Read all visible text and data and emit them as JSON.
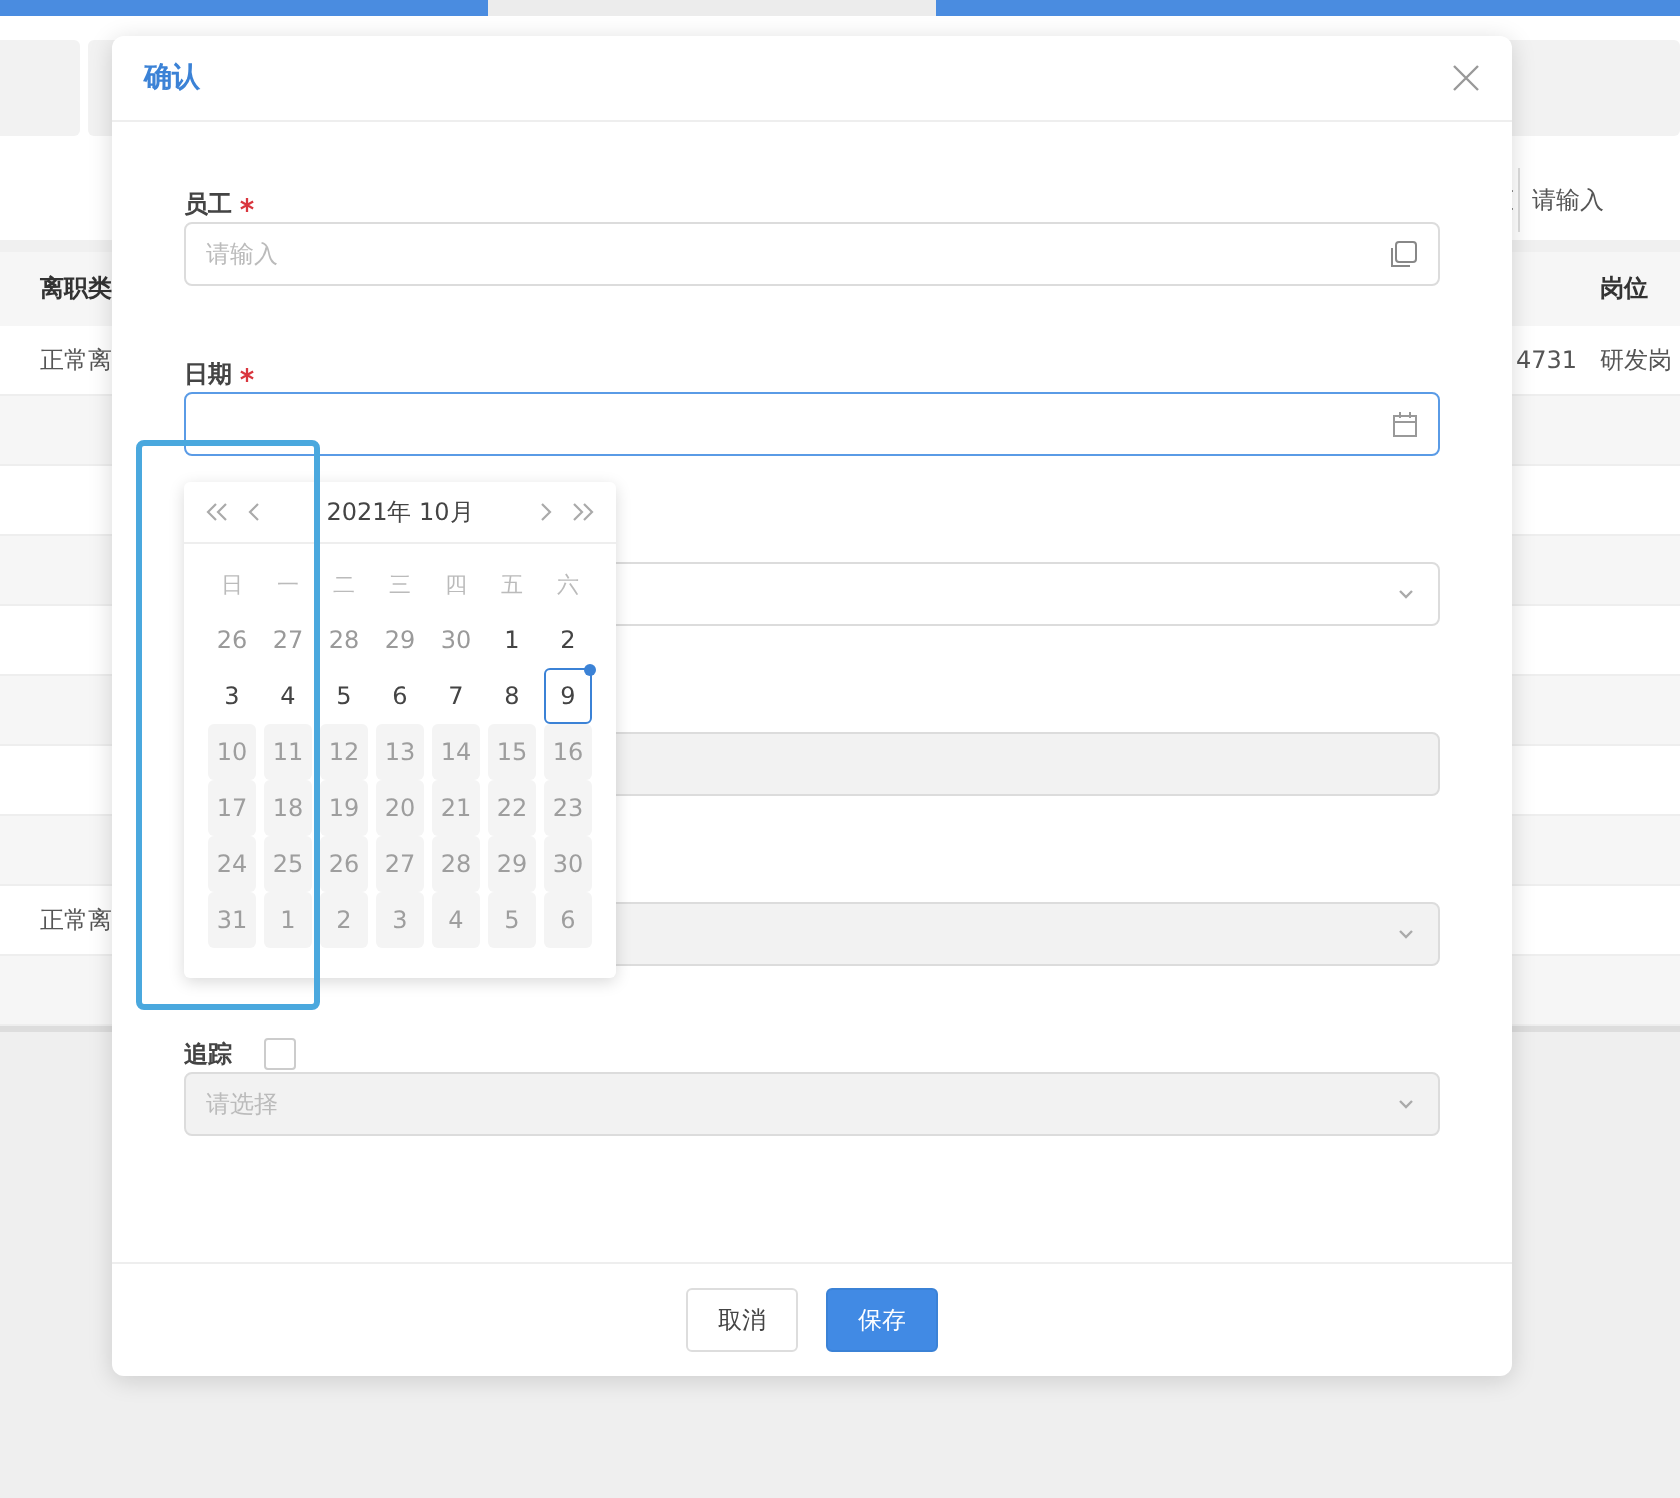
{
  "background": {
    "search": {
      "placeholder": "请输入"
    },
    "table": {
      "columns": [
        "离职类",
        "",
        "岗位"
      ],
      "rows": [
        {
          "cells": [
            "正常离",
            "4731",
            "研发岗"
          ]
        },
        {
          "cells": [
            "",
            "",
            ""
          ]
        },
        {
          "cells": [
            "",
            "",
            ""
          ]
        },
        {
          "cells": [
            "",
            "",
            ""
          ]
        },
        {
          "cells": [
            "",
            "",
            ""
          ]
        },
        {
          "cells": [
            "",
            "",
            ""
          ]
        },
        {
          "cells": [
            "",
            "",
            ""
          ]
        },
        {
          "cells": [
            "",
            "",
            ""
          ]
        },
        {
          "cells": [
            "正常离",
            "",
            ""
          ]
        },
        {
          "cells": [
            "",
            "",
            ""
          ]
        }
      ]
    }
  },
  "dialog": {
    "title": "确认",
    "fields": [
      {
        "kind": "text",
        "label": "员工",
        "required": true,
        "placeholder": "请输入",
        "disabled": false,
        "focused": false
      },
      {
        "kind": "date",
        "label": "日期",
        "required": true,
        "disabled": false,
        "focused": true
      },
      {
        "kind": "select",
        "disabled": false,
        "focused": false
      },
      {
        "kind": "text",
        "disabled": true,
        "focused": false
      },
      {
        "kind": "select",
        "disabled": true,
        "focused": false
      },
      {
        "kind": "select",
        "label": "追踪",
        "checkbox": {
          "checked": false
        },
        "placeholder": "请选择",
        "disabled": true,
        "focused": false
      }
    ],
    "buttons": [
      {
        "label": "取消",
        "primary": false
      },
      {
        "label": "保存",
        "primary": true
      }
    ]
  },
  "calendar": {
    "title": "2021年 10月",
    "weekdays": [
      "日",
      "一",
      "二",
      "三",
      "四",
      "五",
      "六"
    ],
    "days": [
      {
        "label": "26",
        "kind": "outside",
        "selected": false
      },
      {
        "label": "27",
        "kind": "outside",
        "selected": false
      },
      {
        "label": "28",
        "kind": "outside",
        "selected": false
      },
      {
        "label": "29",
        "kind": "outside",
        "selected": false
      },
      {
        "label": "30",
        "kind": "outside",
        "selected": false
      },
      {
        "label": "1",
        "kind": "current",
        "selected": false
      },
      {
        "label": "2",
        "kind": "current",
        "selected": false
      },
      {
        "label": "3",
        "kind": "current",
        "selected": false
      },
      {
        "label": "4",
        "kind": "current",
        "selected": false
      },
      {
        "label": "5",
        "kind": "current",
        "selected": false
      },
      {
        "label": "6",
        "kind": "current",
        "selected": false
      },
      {
        "label": "7",
        "kind": "current",
        "selected": false
      },
      {
        "label": "8",
        "kind": "current",
        "selected": false
      },
      {
        "label": "9",
        "kind": "current",
        "selected": true
      },
      {
        "label": "10",
        "kind": "disabled",
        "selected": false
      },
      {
        "label": "11",
        "kind": "disabled",
        "selected": false
      },
      {
        "label": "12",
        "kind": "disabled",
        "selected": false
      },
      {
        "label": "13",
        "kind": "disabled",
        "selected": false
      },
      {
        "label": "14",
        "kind": "disabled",
        "selected": false
      },
      {
        "label": "15",
        "kind": "disabled",
        "selected": false
      },
      {
        "label": "16",
        "kind": "disabled",
        "selected": false
      },
      {
        "label": "17",
        "kind": "disabled",
        "selected": false
      },
      {
        "label": "18",
        "kind": "disabled",
        "selected": false
      },
      {
        "label": "19",
        "kind": "disabled",
        "selected": false
      },
      {
        "label": "20",
        "kind": "disabled",
        "selected": false
      },
      {
        "label": "21",
        "kind": "disabled",
        "selected": false
      },
      {
        "label": "22",
        "kind": "disabled",
        "selected": false
      },
      {
        "label": "23",
        "kind": "disabled",
        "selected": false
      },
      {
        "label": "24",
        "kind": "disabled",
        "selected": false
      },
      {
        "label": "25",
        "kind": "disabled",
        "selected": false
      },
      {
        "label": "26",
        "kind": "disabled",
        "selected": false
      },
      {
        "label": "27",
        "kind": "disabled",
        "selected": false
      },
      {
        "label": "28",
        "kind": "disabled",
        "selected": false
      },
      {
        "label": "29",
        "kind": "disabled",
        "selected": false
      },
      {
        "label": "30",
        "kind": "disabled",
        "selected": false
      },
      {
        "label": "31",
        "kind": "disabled",
        "selected": false
      },
      {
        "label": "1",
        "kind": "disabled",
        "selected": false
      },
      {
        "label": "2",
        "kind": "disabled",
        "selected": false
      },
      {
        "label": "3",
        "kind": "disabled",
        "selected": false
      },
      {
        "label": "4",
        "kind": "disabled",
        "selected": false
      },
      {
        "label": "5",
        "kind": "disabled",
        "selected": false
      },
      {
        "label": "6",
        "kind": "disabled",
        "selected": false
      }
    ]
  }
}
